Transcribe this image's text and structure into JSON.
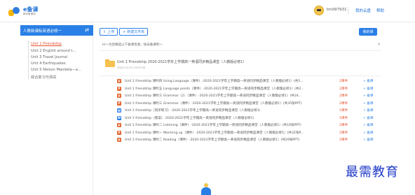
{
  "header": {
    "logo_text": "e备课",
    "logo_subtext": "教师备课网",
    "username": "tm097931",
    "links": [
      "我的云盘",
      "帮助"
    ]
  },
  "sidebar": {
    "title": "人教新课标英语必修一",
    "items": [
      {
        "label": "Unit 1 Friendship",
        "active": true
      },
      {
        "label": "Unit 2 English around t...",
        "active": false
      },
      {
        "label": "Unit 3 Travel Journal",
        "active": false
      },
      {
        "label": "Unit 4 Earthquakes",
        "active": false
      },
      {
        "label": "Unit 5 Nelson Mandela—a...",
        "active": false
      },
      {
        "label": "综合复习与测试",
        "active": false
      }
    ]
  },
  "toolbar": {
    "upload_label": "上传",
    "new_folder_label": "新建文件夹",
    "primary_label": "我的课"
  },
  "hint": {
    "text": "Hi～为您精选以下备课资源，快去备课吧～",
    "close": "×"
  },
  "group": {
    "title": "Unit 1 Friendship 2020-2021学年上学期高一英语同步精品课堂（人教版必修1）",
    "date": "2020-12-23 15:07:00"
  },
  "resources": [
    {
      "icon": "ppt-icon",
      "icon_color": "#e2672e",
      "icon_char": "P",
      "title": "Unit 1 friendship 课时四 Using Language（课件）-2020-2021学年上学期高一英语同步精品课堂（人教版必修1）(共5...",
      "count": "2课件",
      "action": "+ 备课"
    },
    {
      "icon": "ppt-icon",
      "icon_color": "#e2672e",
      "icon_char": "P",
      "title": "Unit 1 friendship 课时五 Language points（课件）-2020-2021学年上学期高一英语同步精品课堂（人教版必修1）(共2...",
      "count": "2课件",
      "action": "+ 备课"
    },
    {
      "icon": "ppt-icon",
      "icon_color": "#e2672e",
      "icon_char": "P",
      "title": "Unit 1 friendship 课时三 Grammar（2）（课件）-2020-2021学年上学期高一英语同步精品课堂（人教版必修1）(共24...",
      "count": "2课件",
      "action": "+ 备课"
    },
    {
      "icon": "ppt-icon",
      "icon_color": "#e2672e",
      "icon_char": "P",
      "title": "Unit 1 friendship 课时三 Grammar（课件）-2020-2021学年上学期高一英语同步精品课堂（人教版必修1）(共35张PPT)",
      "count": "2课件",
      "action": "+ 备课"
    },
    {
      "icon": "word-icon",
      "icon_color": "#2a7fe6",
      "icon_char": "W",
      "title": "Unit 1 friendship（同步练习）-2020-2021学年上学期高一英语同步精品课堂（人教版必修1）",
      "count": "1课件",
      "action": "+ 备课"
    },
    {
      "icon": "word-icon",
      "icon_color": "#2a7fe6",
      "icon_char": "W",
      "title": "Unit 1 friendship（教案）-2020-2021学年上学期高一英语同步精品课堂（人教版必修1）",
      "count": "1课件",
      "action": "+ 备课"
    },
    {
      "icon": "ppt-icon",
      "icon_color": "#e2672e",
      "icon_char": "P",
      "title": "Unit 1 friendship 课时二 Listening（课件）-2020-2021学年上学期高一英语同步精品课堂（人教版必修1）(共16张PPT)",
      "count": "2课件",
      "action": "+ 备课"
    },
    {
      "icon": "ppt-icon",
      "icon_color": "#e2672e",
      "icon_char": "P",
      "title": "Unit 1 friendship 课时一 Warming up（课件）-2020-2021学年上学期高一英语同步精品课堂（人教版必修1）(共32张P...",
      "count": "2课件",
      "action": "+ 备课"
    },
    {
      "icon": "ppt-icon",
      "icon_color": "#e2672e",
      "icon_char": "P",
      "title": "Unit 1 friendship 课时二 Reading（课件）-2020-2021学年上学期高一英语同步精品课堂（人教版必修1）(共29张PPT)",
      "count": "2课件",
      "action": "+ 备课"
    }
  ],
  "watermark": "最需教育",
  "colors": {
    "accent": "#2a7fe6",
    "active": "#e2502c",
    "folder": "#f7c14f"
  }
}
